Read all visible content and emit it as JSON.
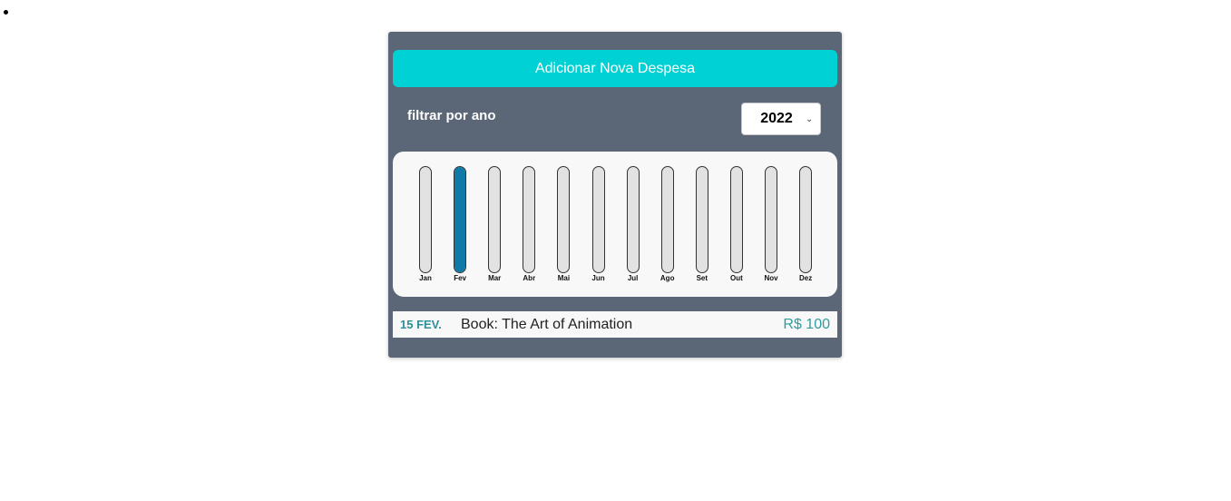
{
  "add_button": {
    "label": "Adicionar Nova Despesa"
  },
  "filter": {
    "label": "filtrar por ano",
    "selected_year": "2022"
  },
  "chart_data": {
    "type": "bar",
    "categories": [
      "Jan",
      "Fev",
      "Mar",
      "Abr",
      "Mai",
      "Jun",
      "Jul",
      "Ago",
      "Set",
      "Out",
      "Nov",
      "Dez"
    ],
    "values": [
      0,
      100,
      0,
      0,
      0,
      0,
      0,
      0,
      0,
      0,
      0,
      0
    ],
    "ylim": [
      0,
      100
    ],
    "colors": {
      "fill": "#0f7aa8",
      "track": "#e2e2e2"
    }
  },
  "expenses": [
    {
      "date": "15 FEV.",
      "description": "Book: The Art of Animation",
      "amount": "R$ 100"
    }
  ]
}
